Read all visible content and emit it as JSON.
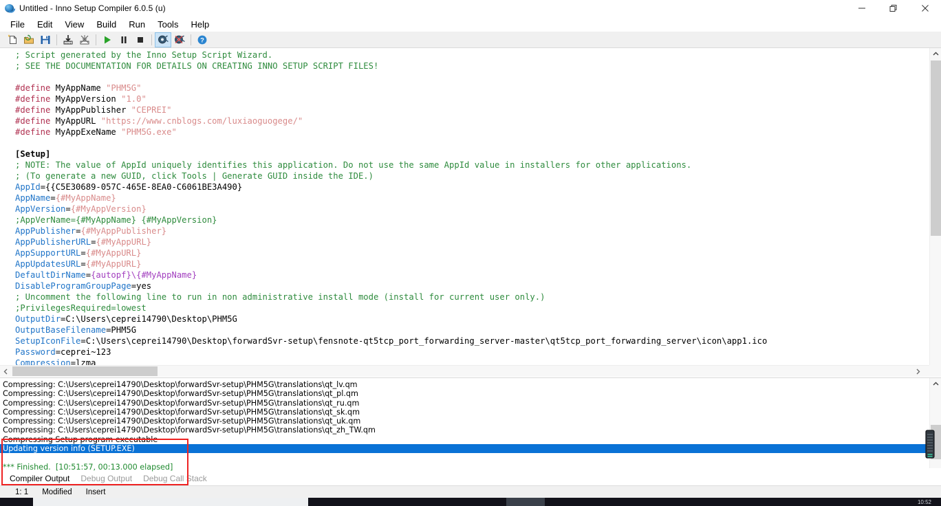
{
  "window": {
    "title": "Untitled - Inno Setup Compiler 6.0.5 (u)",
    "icon": "inno-setup-globe-icon",
    "controls": {
      "minimize": "minimize-icon",
      "restore": "restore-icon",
      "close": "close-icon"
    }
  },
  "menubar": {
    "items": [
      {
        "label": "File"
      },
      {
        "label": "Edit"
      },
      {
        "label": "View"
      },
      {
        "label": "Build"
      },
      {
        "label": "Run"
      },
      {
        "label": "Tools"
      },
      {
        "label": "Help"
      }
    ]
  },
  "toolbar": {
    "buttons": [
      {
        "name": "new-file-icon"
      },
      {
        "name": "open-file-icon"
      },
      {
        "name": "save-file-icon"
      },
      {
        "name": "compile-icon"
      },
      {
        "name": "stop-compile-icon"
      },
      {
        "name": "run-icon"
      },
      {
        "name": "pause-icon"
      },
      {
        "name": "stop-icon"
      },
      {
        "name": "target-icon"
      },
      {
        "name": "target-off-icon"
      },
      {
        "name": "help-icon"
      }
    ]
  },
  "editor": {
    "lines": [
      {
        "type": "comment",
        "text": "; Script generated by the Inno Setup Script Wizard."
      },
      {
        "type": "comment",
        "text": "; SEE THE DOCUMENTATION FOR DETAILS ON CREATING INNO SETUP SCRIPT FILES!"
      },
      {
        "type": "blank",
        "text": ""
      },
      {
        "type": "define",
        "keyword": "#define",
        "ident": " MyAppName ",
        "string": "\"PHM5G\""
      },
      {
        "type": "define",
        "keyword": "#define",
        "ident": " MyAppVersion ",
        "string": "\"1.0\""
      },
      {
        "type": "define",
        "keyword": "#define",
        "ident": " MyAppPublisher ",
        "string": "\"CEPREI\""
      },
      {
        "type": "define",
        "keyword": "#define",
        "ident": " MyAppURL ",
        "string": "\"https://www.cnblogs.com/luxiaoguogege/\""
      },
      {
        "type": "define",
        "keyword": "#define",
        "ident": " MyAppExeName ",
        "string": "\"PHM5G.exe\""
      },
      {
        "type": "blank",
        "text": ""
      },
      {
        "type": "section",
        "text": "[Setup]"
      },
      {
        "type": "comment",
        "text": "; NOTE: The value of AppId uniquely identifies this application. Do not use the same AppId value in installers for other applications."
      },
      {
        "type": "comment",
        "text": "; (To generate a new GUID, click Tools | Generate GUID inside the IDE.)"
      },
      {
        "type": "kv",
        "key": "AppId",
        "op": "=",
        "value": "{{C5E30689-057C-465E-8EA0-C6061BE3A490}",
        "value_style": "plain"
      },
      {
        "type": "kv",
        "key": "AppName",
        "op": "=",
        "value": "{#MyAppName}",
        "value_style": "macro"
      },
      {
        "type": "kv",
        "key": "AppVersion",
        "op": "=",
        "value": "{#MyAppVersion}",
        "value_style": "macro"
      },
      {
        "type": "comment",
        "text": ";AppVerName={#MyAppName} {#MyAppVersion}"
      },
      {
        "type": "kv",
        "key": "AppPublisher",
        "op": "=",
        "value": "{#MyAppPublisher}",
        "value_style": "macro"
      },
      {
        "type": "kv",
        "key": "AppPublisherURL",
        "op": "=",
        "value": "{#MyAppURL}",
        "value_style": "macro"
      },
      {
        "type": "kv",
        "key": "AppSupportURL",
        "op": "=",
        "value": "{#MyAppURL}",
        "value_style": "macro"
      },
      {
        "type": "kv",
        "key": "AppUpdatesURL",
        "op": "=",
        "value": "{#MyAppURL}",
        "value_style": "macro"
      },
      {
        "type": "kv",
        "key": "DefaultDirName",
        "op": "=",
        "value": "{autopf}\\{#MyAppName}",
        "value_style": "const"
      },
      {
        "type": "kv",
        "key": "DisableProgramGroupPage",
        "op": "=",
        "value": "yes",
        "value_style": "plain"
      },
      {
        "type": "comment",
        "text": "; Uncomment the following line to run in non administrative install mode (install for current user only.)"
      },
      {
        "type": "comment",
        "text": ";PrivilegesRequired=lowest"
      },
      {
        "type": "kv",
        "key": "OutputDir",
        "op": "=",
        "value": "C:\\Users\\ceprei14790\\Desktop\\PHM5G",
        "value_style": "plain"
      },
      {
        "type": "kv",
        "key": "OutputBaseFilename",
        "op": "=",
        "value": "PHM5G",
        "value_style": "plain"
      },
      {
        "type": "kv",
        "key": "SetupIconFile",
        "op": "=",
        "value": "C:\\Users\\ceprei14790\\Desktop\\forwardSvr-setup\\fensnote-qt5tcp_port_forwarding_server-master\\qt5tcp_port_forwarding_server\\icon\\app1.ico",
        "value_style": "plain"
      },
      {
        "type": "kv",
        "key": "Password",
        "op": "=",
        "value": "ceprei~123",
        "value_style": "plain"
      },
      {
        "type": "kv",
        "key": "Compression",
        "op": "=",
        "value": "lzma",
        "value_style": "plain"
      }
    ]
  },
  "output": {
    "lines": [
      {
        "text": "Compressing: C:\\Users\\ceprei14790\\Desktop\\forwardSvr-setup\\PHM5G\\translations\\qt_lv.qm",
        "style": "normal"
      },
      {
        "text": "Compressing: C:\\Users\\ceprei14790\\Desktop\\forwardSvr-setup\\PHM5G\\translations\\qt_pl.qm",
        "style": "normal"
      },
      {
        "text": "Compressing: C:\\Users\\ceprei14790\\Desktop\\forwardSvr-setup\\PHM5G\\translations\\qt_ru.qm",
        "style": "normal"
      },
      {
        "text": "Compressing: C:\\Users\\ceprei14790\\Desktop\\forwardSvr-setup\\PHM5G\\translations\\qt_sk.qm",
        "style": "normal"
      },
      {
        "text": "Compressing: C:\\Users\\ceprei14790\\Desktop\\forwardSvr-setup\\PHM5G\\translations\\qt_uk.qm",
        "style": "normal"
      },
      {
        "text": "Compressing: C:\\Users\\ceprei14790\\Desktop\\forwardSvr-setup\\PHM5G\\translations\\qt_zh_TW.qm",
        "style": "normal"
      },
      {
        "text": "Compressing Setup program executable",
        "style": "normal"
      },
      {
        "text": "Updating version info (SETUP.EXE)",
        "style": "selected"
      },
      {
        "text": "",
        "style": "normal"
      },
      {
        "text": "*** Finished.  [10:51:57, 00:13.000 elapsed]",
        "style": "finished"
      }
    ],
    "tabs": [
      {
        "label": "Compiler Output",
        "active": true
      },
      {
        "label": "Debug Output",
        "active": false
      },
      {
        "label": "Debug Call Stack",
        "active": false
      }
    ]
  },
  "statusbar": {
    "position": "1:  1",
    "modified": "Modified",
    "insert_mode": "Insert"
  },
  "taskbar": {
    "clock": "10:52"
  },
  "annotation": {
    "name": "red-highlight-rectangle",
    "color": "#ee2222"
  },
  "colors": {
    "comment": "#2e8b3d",
    "define": "#b03050",
    "string": "#d98b8b",
    "key": "#1f74c8",
    "constant": "#a23fbf",
    "selection": "#0a72d6",
    "finished": "#1f8a2f"
  }
}
